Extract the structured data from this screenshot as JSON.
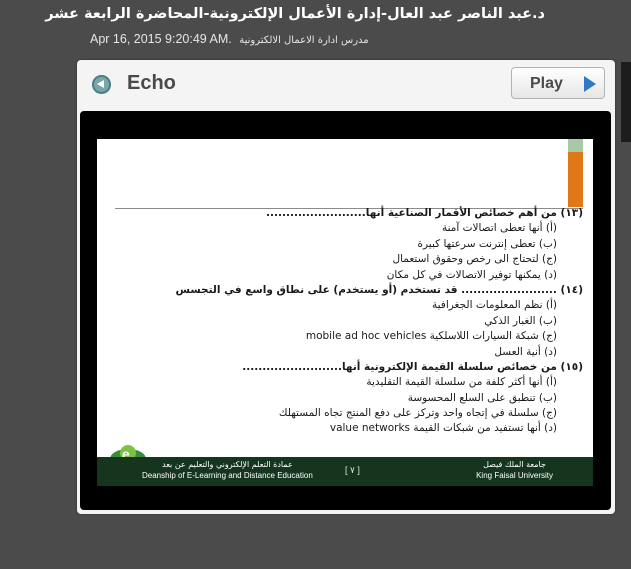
{
  "header": {
    "title": "د.عبد الناصر عبد العال-إدارة الأعمال الإلكترونية-المحاضرة الرابعة عشر",
    "date": "Apr 16, 2015 9:20:49 AM.",
    "course": "مدرس ادارة الاعمال الالكترونية"
  },
  "player": {
    "app_name": "Echo",
    "echo_icon": "echo-replay-icon",
    "play_label": "Play",
    "play_icon": "play-triangle-icon",
    "colors": {
      "play_icon": "#2d7bc4",
      "slide_accent": "#e07818",
      "footer": "#15351f"
    }
  },
  "slide": {
    "lines": [
      "(١٣) من أهم   خصائص الأقمار الصناعية أنها.........................",
      "(أ)  أنها تعطى اتصالات آمنة",
      "(ب) تعطى إنترنت سرعتها كبيرة",
      "(ج) لتحتاج الى رخص وحقوق استعمال",
      "(د) يمكنها توفير الاتصالات في كل مكان",
      "(١٤) ........................ قد تستخدم (أو يستخدم) على نطاق واسع في التجسس",
      "(أ) نظم المعلومات الجغرافية",
      "(ب) الغبار الذكي",
      "(ج) شبكة السيارات اللاسلكية mobile ad hoc vehicles",
      "(د) أنية العسل",
      "(١٥) من خصائص سلسلة القيمة الإلكترونية أنها.........................",
      "(أ)  أنها أكثر كلفة من سلسلة القيمة التقليدية",
      "(ب)  تنطبق على السلع المحسوسة",
      "(ج) سلسلة في إتجاه واحد وتركز على دفع المنتج تجاه المستهلك",
      "(د)  أنها تستفيد من شبكات القيمة value networks"
    ],
    "footer": {
      "university_ar": "جامعة الملك فيصل",
      "university_en": "King Faisal University",
      "page": "[ ٧ ]",
      "deanship_ar": "عمادة التعلم الإلكتروني والتعليم عن بعد",
      "deanship_en": "Deanship of E-Learning and Distance Education"
    }
  }
}
